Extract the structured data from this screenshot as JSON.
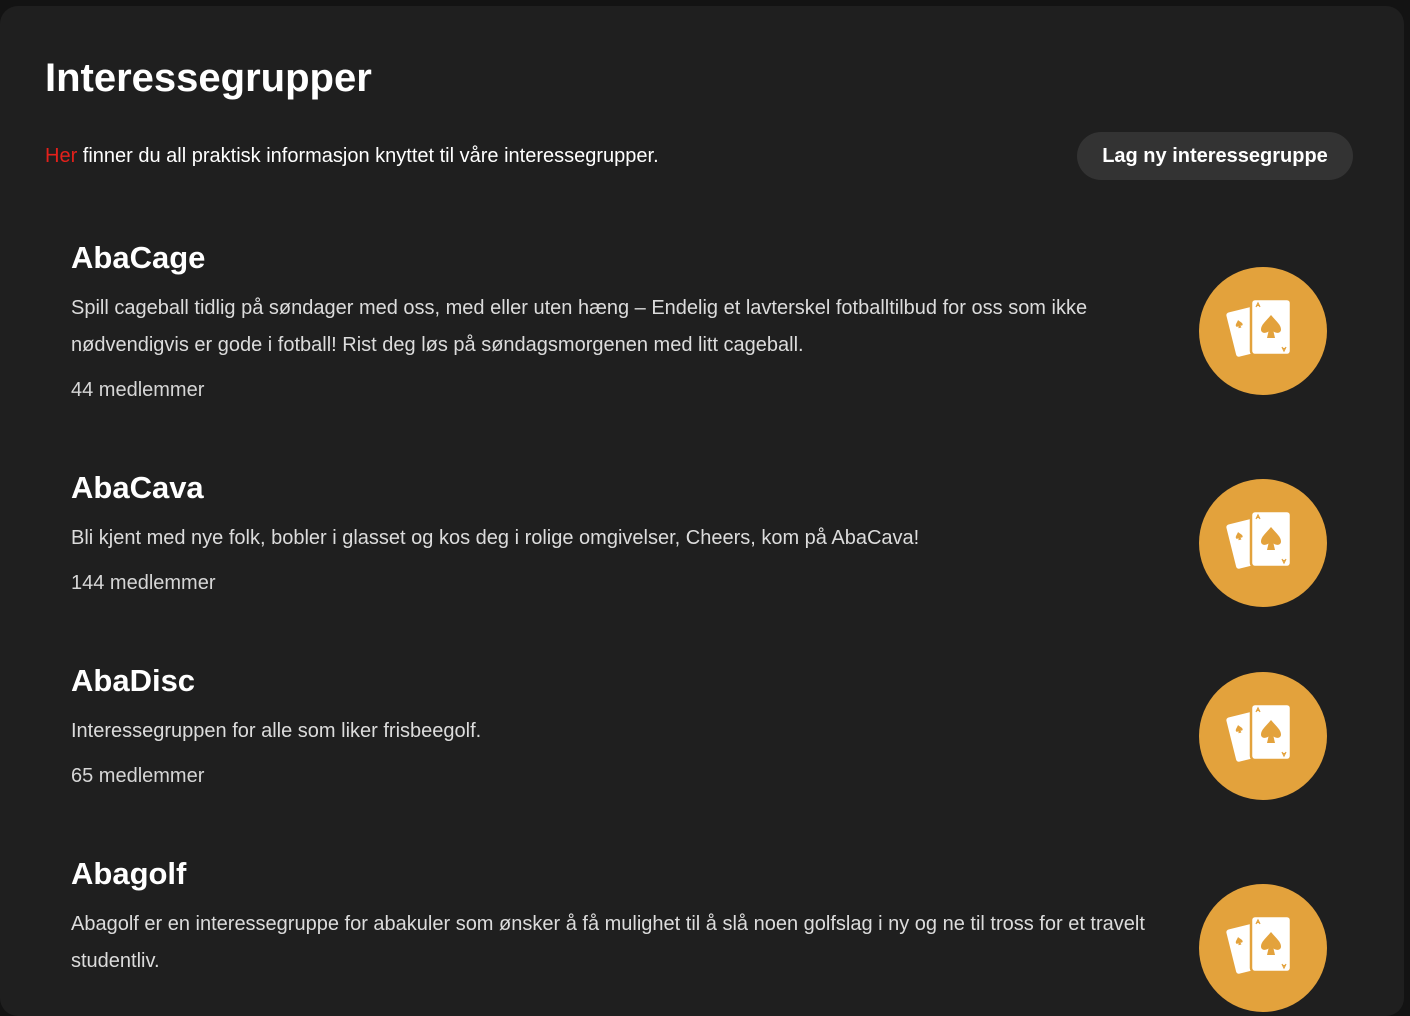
{
  "page": {
    "title": "Interessegrupper",
    "intro_link": "Her",
    "intro_text": " finner du all praktisk informasjon knyttet til våre interessegrupper.",
    "new_group_button": "Lag ny interessegruppe"
  },
  "groups": [
    {
      "name": "AbaCage",
      "description": "Spill cageball tidlig på søndager med oss, med eller uten hæng – Endelig et lavterskel fotballtilbud for oss som ikke nødvendigvis er gode i fotball! Rist deg løs på søndagsmorgenen med litt cageball.",
      "members": "44 medlemmer",
      "icon": "playing-cards-icon"
    },
    {
      "name": "AbaCava",
      "description": "Bli kjent med nye folk, bobler i glasset og kos deg i rolige omgivelser, Cheers, kom på AbaCava!",
      "members": "144 medlemmer",
      "icon": "playing-cards-icon"
    },
    {
      "name": "AbaDisc",
      "description": "Interessegruppen for alle som liker frisbeegolf.",
      "members": "65 medlemmer",
      "icon": "playing-cards-icon"
    },
    {
      "name": "Abagolf",
      "description": "Abagolf er en interessegruppe for abakuler som ønsker å få mulighet til å slå noen golfslag i ny og ne til tross for et travelt studentliv.",
      "members": "",
      "icon": "playing-cards-icon"
    }
  ],
  "colors": {
    "background": "#1f1f1f",
    "accent_link": "#e3201b",
    "logo_circle": "#e3a23c",
    "button_bg": "#333333"
  }
}
